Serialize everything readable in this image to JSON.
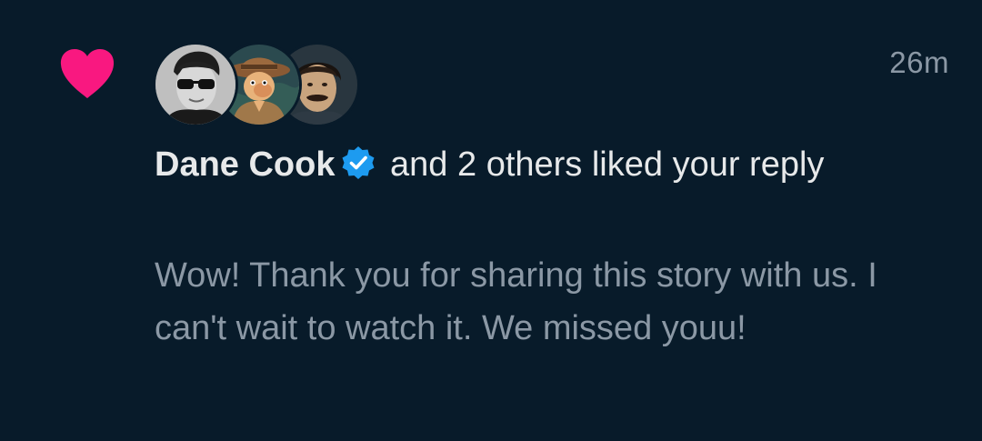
{
  "notification": {
    "type_icon": "heart-icon",
    "timestamp": "26m",
    "avatars": [
      {
        "icon": "avatar-sunglasses-man"
      },
      {
        "icon": "avatar-cartoon-cowboy"
      },
      {
        "icon": "avatar-mustache-man"
      }
    ],
    "user_name": "Dane Cook",
    "verified_icon": "verified-badge-icon",
    "action_text": " and 2 others liked your reply",
    "reply_text": "Wow! Thank you for sharing this story with us. I can't wait to watch it. We missed youu!"
  },
  "colors": {
    "background": "#081b2a",
    "heart": "#f91880",
    "verified": "#1d9bf0",
    "primary_text": "#e7e9ea",
    "secondary_text": "#8b98a5"
  }
}
